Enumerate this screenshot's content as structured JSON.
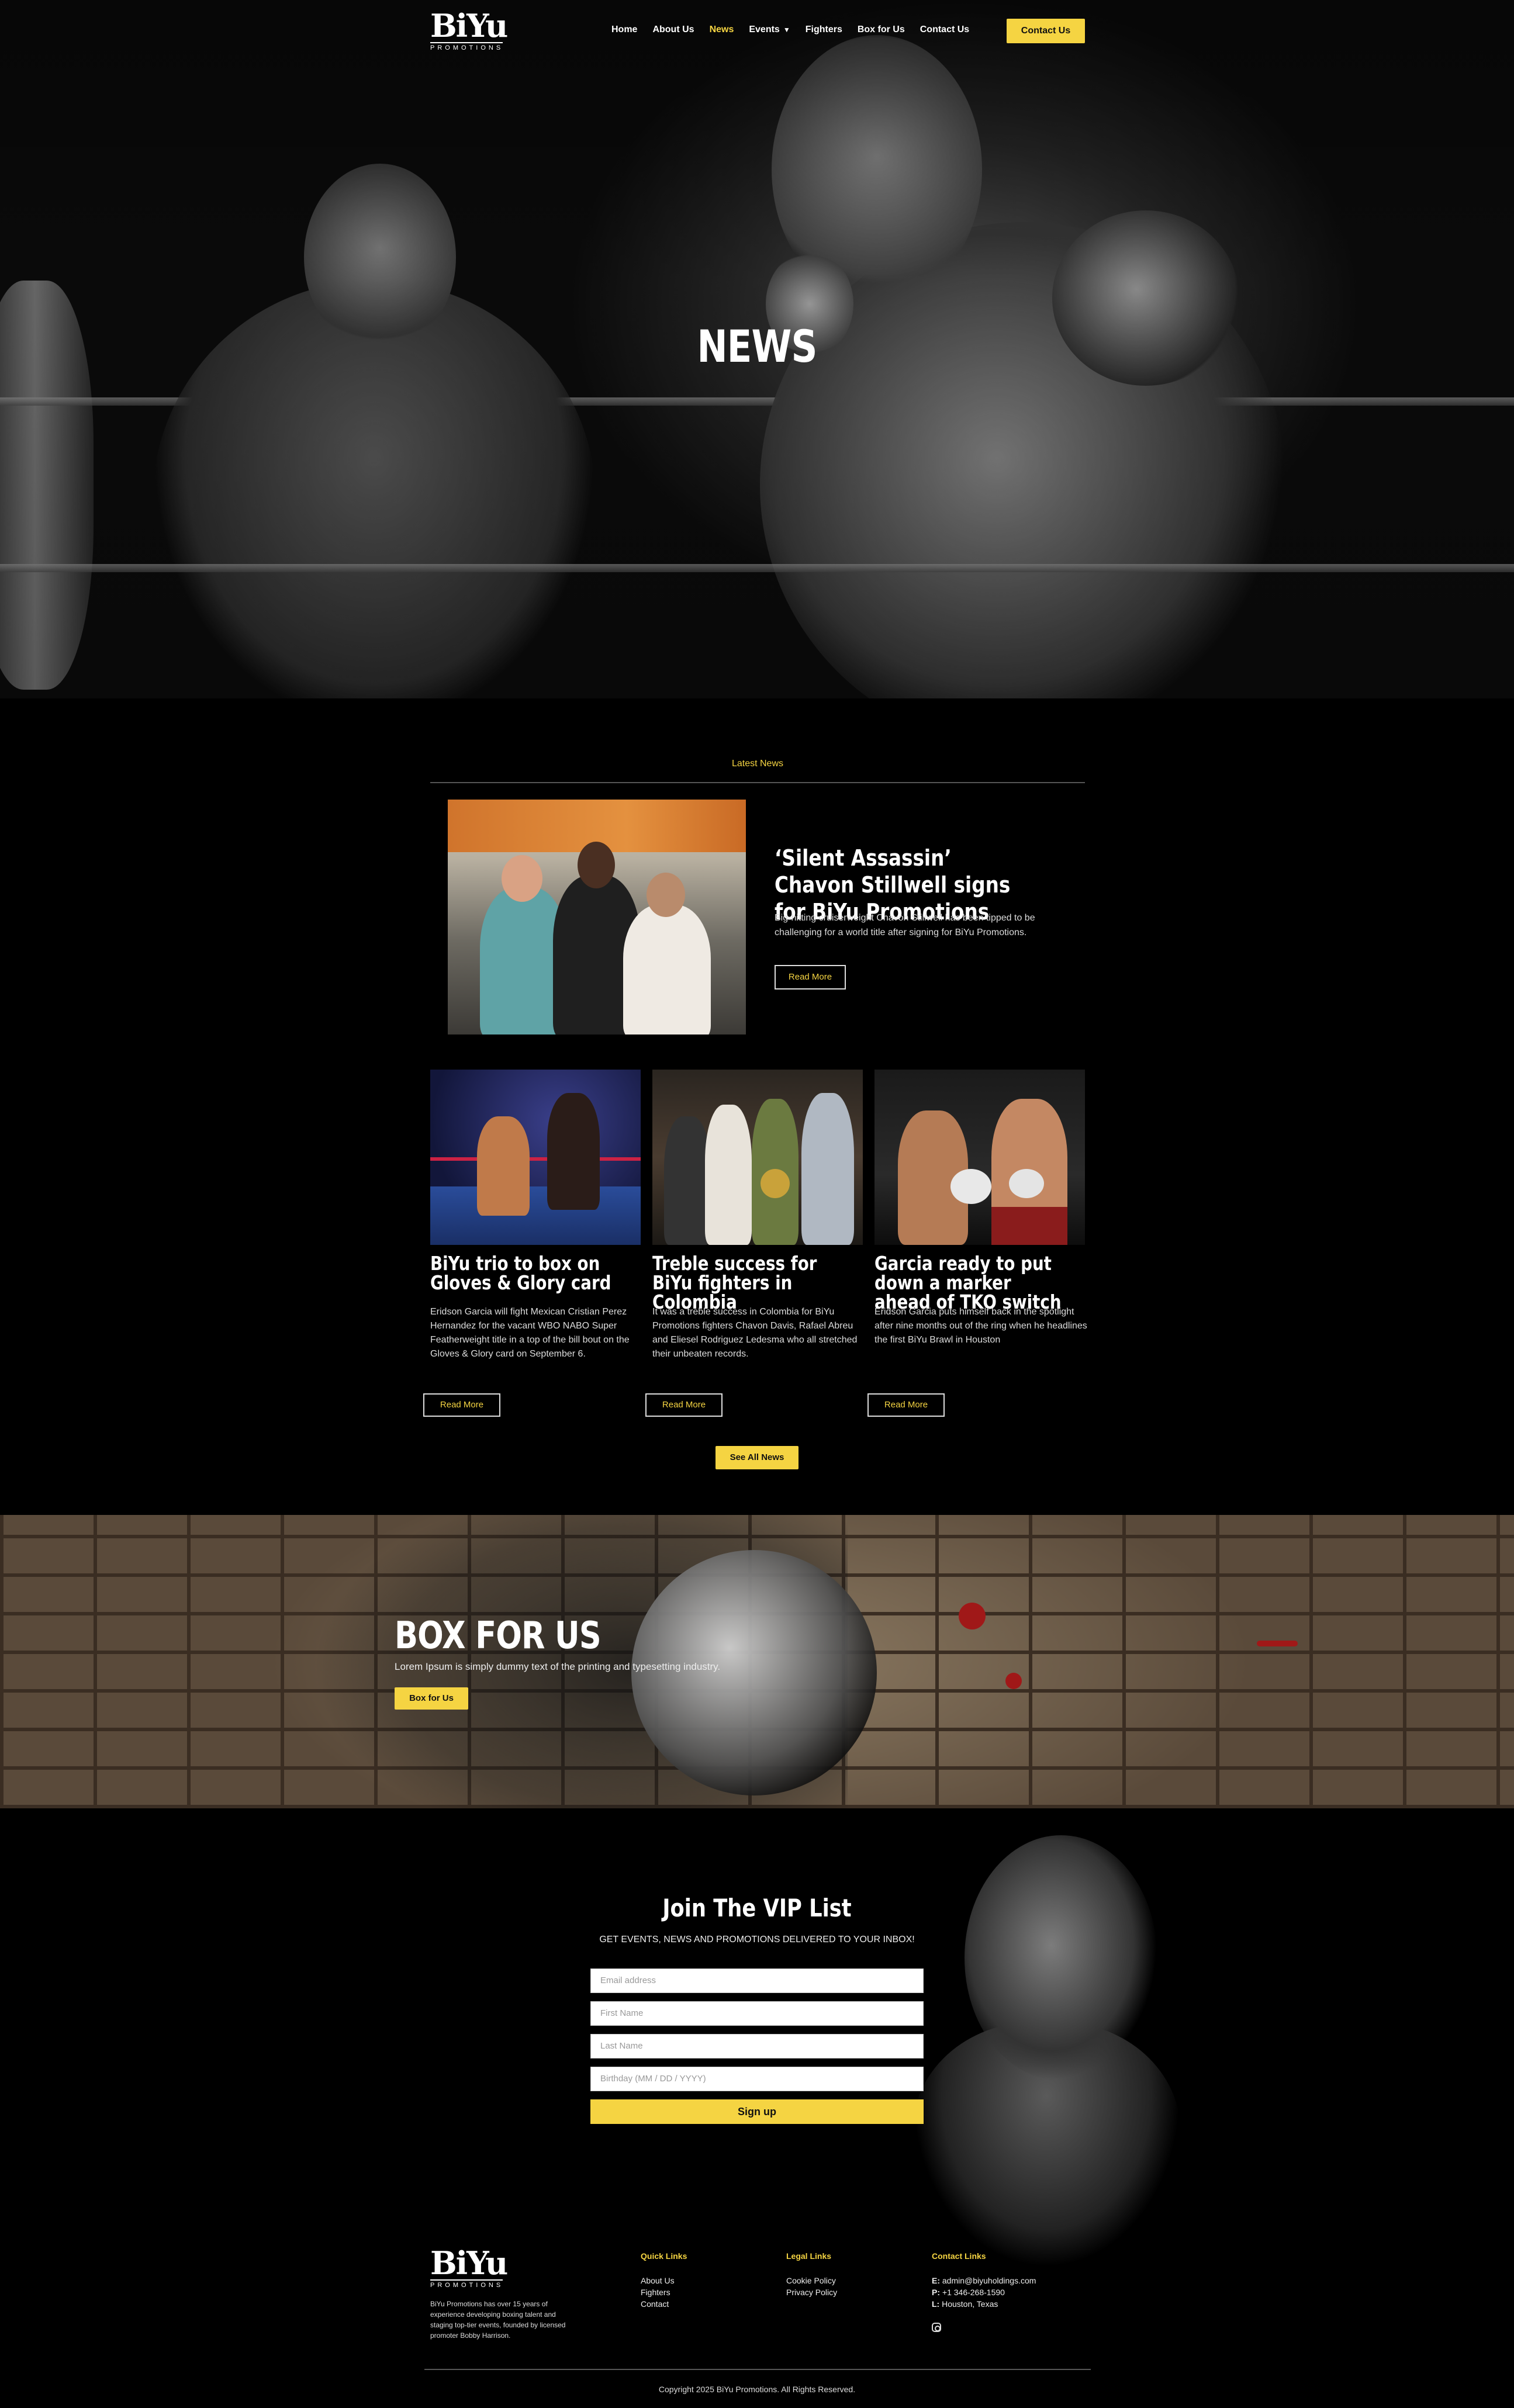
{
  "nav": {
    "logo_text": "BiYu",
    "logo_sub": "PROMOTIONS",
    "items": [
      {
        "label": "Home"
      },
      {
        "label": "About Us"
      },
      {
        "label": "News"
      },
      {
        "label": "Events"
      },
      {
        "label": "Fighters"
      },
      {
        "label": "Box for Us"
      },
      {
        "label": "Contact Us"
      }
    ],
    "contact_button": "Contact Us"
  },
  "hero": {
    "title": "NEWS"
  },
  "news": {
    "section_label": "Latest News",
    "featured": {
      "title": "‘Silent Assassin’ Chavon Stillwell signs for BiYu Promotions",
      "description": "Big-hitting cruiserweight Chavon Stillwell has been tipped to be challenging for a world title after signing for BiYu Promotions.",
      "button": "Read More"
    },
    "cards": [
      {
        "title": "BiYu trio to box on Gloves & Glory card",
        "description": "Eridson Garcia will fight Mexican Cristian Perez Hernandez for the vacant WBO NABO Super Featherweight title in a top of the bill bout on the Gloves & Glory card on September 6.",
        "button": "Read More"
      },
      {
        "title": "Treble success for BiYu fighters in Colombia",
        "description": "It was a treble success in Colombia for BiYu Promotions fighters Chavon Davis, Rafael Abreu and Eliesel Rodriguez Ledesma who all stretched their unbeaten records.",
        "button": "Read More"
      },
      {
        "title": "Garcia ready to put down a marker ahead of TKO switch",
        "description": "Eridson Garcia puts himself back in the spotlight after nine months out of the ring when he headlines the first BiYu Brawl in Houston",
        "button": "Read More"
      }
    ],
    "see_all": "See All News"
  },
  "box_for_us": {
    "title": "BOX FOR US",
    "text": "Lorem Ipsum is simply dummy text of the printing and typesetting industry.",
    "button": "Box for Us"
  },
  "vip": {
    "title": "Join The VIP List",
    "subtitle": "GET EVENTS, NEWS AND PROMOTIONS DELIVERED TO YOUR INBOX!",
    "fields": {
      "email": "Email address",
      "first_name": "First Name",
      "last_name": "Last Name",
      "birthday": "Birthday (MM / DD / YYYY)"
    },
    "submit": "Sign up"
  },
  "footer": {
    "logo_text": "BiYu",
    "logo_sub": "PROMOTIONS",
    "about": "BiYu Promotions has over 15 years of experience developing boxing talent and staging top-tier events, founded by licensed promoter Bobby Harrison.",
    "quick_links": {
      "heading": "Quick Links",
      "items": [
        "About Us",
        "Fighters",
        "Contact"
      ]
    },
    "legal_links": {
      "heading": "Legal Links",
      "items": [
        "Cookie Policy",
        "Privacy Policy"
      ]
    },
    "contact": {
      "heading": "Contact Links",
      "email_label": "E:",
      "email": "admin@biyuholdings.com",
      "phone_label": "P:",
      "phone": "+1 346-268-1590",
      "location_label": "L:",
      "location": "Houston, Texas"
    },
    "copyright": "Copyright 2025 BiYu Promotions. All Rights Reserved."
  },
  "colors": {
    "accent": "#f5d442",
    "background": "#000000"
  }
}
